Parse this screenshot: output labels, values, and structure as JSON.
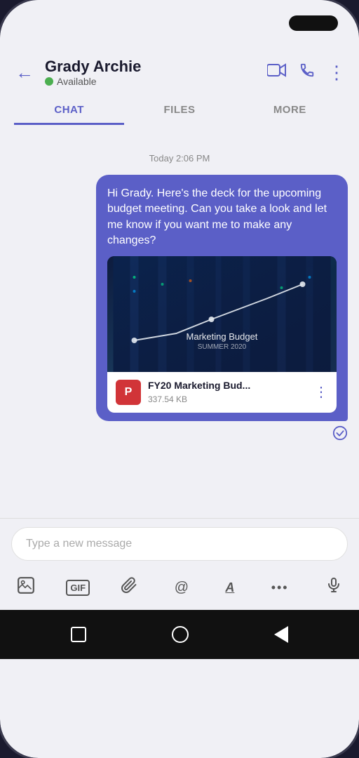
{
  "header": {
    "contact_name": "Grady Archie",
    "contact_status": "Available",
    "back_label": "←"
  },
  "tabs": [
    {
      "id": "chat",
      "label": "CHAT",
      "active": true
    },
    {
      "id": "files",
      "label": "FILES",
      "active": false
    },
    {
      "id": "more",
      "label": "MORE",
      "active": false
    }
  ],
  "chat": {
    "timestamp": "Today 2:06 PM",
    "message_text": "Hi Grady. Here's the deck for the upcoming budget meeting. Can you take a look and let me know if you want me to make any changes?",
    "attachment": {
      "preview_title": "Marketing Budget",
      "preview_subtitle": "SUMMER 2020",
      "file_name": "FY20 Marketing Bud...",
      "file_size": "337.54 KB"
    }
  },
  "input": {
    "placeholder": "Type a new message"
  },
  "toolbar_icons": [
    {
      "name": "image-icon",
      "symbol": "🖼"
    },
    {
      "name": "gif-icon",
      "symbol": "GIF"
    },
    {
      "name": "attachment-icon",
      "symbol": "📎"
    },
    {
      "name": "mention-icon",
      "symbol": "@"
    },
    {
      "name": "format-icon",
      "symbol": "A"
    },
    {
      "name": "more-icon",
      "symbol": "•••"
    },
    {
      "name": "mic-icon",
      "symbol": "🎤"
    }
  ],
  "colors": {
    "accent": "#5b5fc7",
    "status_green": "#4caf50",
    "ppt_red": "#d13438"
  }
}
